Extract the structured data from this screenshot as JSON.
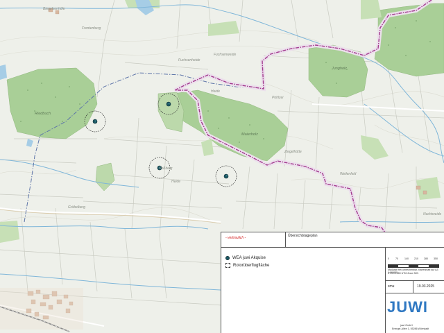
{
  "map": {
    "place_labels": [
      {
        "id": "biegel",
        "text": "Biegelsenhöfe"
      },
      {
        "id": "fronten",
        "text": "Frontenberg"
      },
      {
        "id": "fuchsenw",
        "text": "Fuchsenweide"
      },
      {
        "id": "fuchsenh",
        "text": "Fuchsenheide"
      },
      {
        "id": "riedbuch",
        "text": "Riedbuch"
      },
      {
        "id": "jungholz",
        "text": "Jungholz"
      },
      {
        "id": "maierholz",
        "text": "Maierholz"
      },
      {
        "id": "ziegelhuette",
        "text": "Ziegelhütte"
      },
      {
        "id": "weilenfeld",
        "text": "Weilenfeld"
      },
      {
        "id": "groebelberg",
        "text": "Gröbelberg"
      },
      {
        "id": "nachtweide",
        "text": "Nachtweide"
      },
      {
        "id": "heide1",
        "text": "Heide"
      },
      {
        "id": "heide2",
        "text": "Heide"
      },
      {
        "id": "rosberg",
        "text": "Roßberg"
      },
      {
        "id": "pohlzei",
        "text": "Pohlzei"
      }
    ]
  },
  "legend": {
    "confidential": "- vertraulich -",
    "plan_title": "Übersichtslageplan",
    "items": [
      {
        "label": "WEA juwi Akquise",
        "symbol": "turbine-dot"
      },
      {
        "label": "Rotorüberflugfläche",
        "symbol": "dashed-area"
      }
    ],
    "scale_numbers": [
      "0",
      "70",
      "140",
      "210",
      "280",
      "350"
    ],
    "scale_line1": "Maßstab frei umrechenbar, Kartenblatt auf A3 1:10.000",
    "scale_line2": "ETRS 1989 UTM Zone 32N",
    "author": "smu",
    "date": "19.03.2025",
    "company_name": "juwi GmbH",
    "company_address": "Energie-Allee 1, 55286 Wörrstadt",
    "logo_text": "JUWI",
    "logo_color": "#2f78c2",
    "logo_accent": "#8cc63f"
  }
}
